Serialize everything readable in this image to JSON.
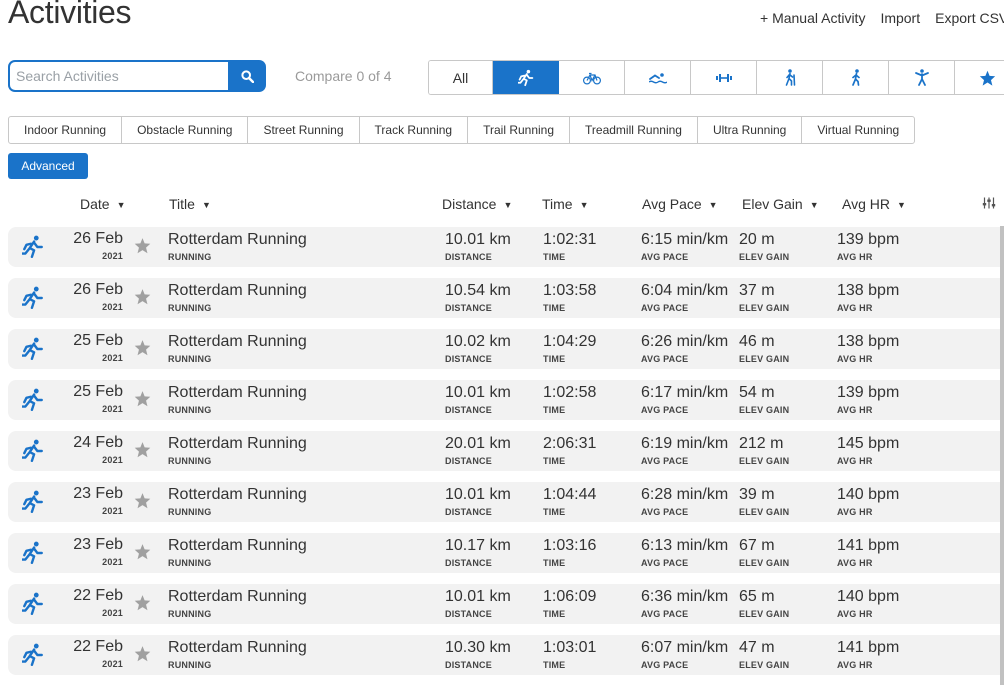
{
  "page": {
    "title": "Activities",
    "actions": [
      "+ Manual Activity",
      "Import",
      "Export CSV"
    ]
  },
  "search": {
    "placeholder": "Search Activities",
    "value": ""
  },
  "compare_label": "Compare 0 of 4",
  "filters": {
    "all_label": "All",
    "icons": [
      "running-icon",
      "cycling-icon",
      "swimming-icon",
      "strength-icon",
      "hiking-icon",
      "walking-icon",
      "fitness-icon",
      "favorites-star-icon"
    ],
    "active": "running-icon"
  },
  "subtypes": [
    "Indoor Running",
    "Obstacle Running",
    "Street Running",
    "Track Running",
    "Trail Running",
    "Treadmill Running",
    "Ultra Running",
    "Virtual Running"
  ],
  "advanced_label": "Advanced",
  "columns": {
    "date": "Date",
    "title": "Title",
    "distance": "Distance",
    "time": "Time",
    "pace": "Avg Pace",
    "elev": "Elev Gain",
    "hr": "Avg HR"
  },
  "sublabels": {
    "distance": "DISTANCE",
    "time": "TIME",
    "pace": "AVG PACE",
    "elev": "ELEV GAIN",
    "hr": "AVG HR"
  },
  "colors": {
    "accent": "#1a73c9",
    "row_bg": "#f2f2f2",
    "star": "#a0a0a0"
  },
  "activities": [
    {
      "date": "26 Feb",
      "year": "2021",
      "title": "Rotterdam Running",
      "type": "RUNNING",
      "distance": "10.01 km",
      "time": "1:02:31",
      "pace": "6:15 min/km",
      "elev": "20 m",
      "hr": "139 bpm"
    },
    {
      "date": "26 Feb",
      "year": "2021",
      "title": "Rotterdam Running",
      "type": "RUNNING",
      "distance": "10.54 km",
      "time": "1:03:58",
      "pace": "6:04 min/km",
      "elev": "37 m",
      "hr": "138 bpm"
    },
    {
      "date": "25 Feb",
      "year": "2021",
      "title": "Rotterdam Running",
      "type": "RUNNING",
      "distance": "10.02 km",
      "time": "1:04:29",
      "pace": "6:26 min/km",
      "elev": "46 m",
      "hr": "138 bpm"
    },
    {
      "date": "25 Feb",
      "year": "2021",
      "title": "Rotterdam Running",
      "type": "RUNNING",
      "distance": "10.01 km",
      "time": "1:02:58",
      "pace": "6:17 min/km",
      "elev": "54 m",
      "hr": "139 bpm"
    },
    {
      "date": "24 Feb",
      "year": "2021",
      "title": "Rotterdam Running",
      "type": "RUNNING",
      "distance": "20.01 km",
      "time": "2:06:31",
      "pace": "6:19 min/km",
      "elev": "212 m",
      "hr": "145 bpm"
    },
    {
      "date": "23 Feb",
      "year": "2021",
      "title": "Rotterdam Running",
      "type": "RUNNING",
      "distance": "10.01 km",
      "time": "1:04:44",
      "pace": "6:28 min/km",
      "elev": "39 m",
      "hr": "140 bpm"
    },
    {
      "date": "23 Feb",
      "year": "2021",
      "title": "Rotterdam Running",
      "type": "RUNNING",
      "distance": "10.17 km",
      "time": "1:03:16",
      "pace": "6:13 min/km",
      "elev": "67 m",
      "hr": "141 bpm"
    },
    {
      "date": "22 Feb",
      "year": "2021",
      "title": "Rotterdam Running",
      "type": "RUNNING",
      "distance": "10.01 km",
      "time": "1:06:09",
      "pace": "6:36 min/km",
      "elev": "65 m",
      "hr": "140 bpm"
    },
    {
      "date": "22 Feb",
      "year": "2021",
      "title": "Rotterdam Running",
      "type": "RUNNING",
      "distance": "10.30 km",
      "time": "1:03:01",
      "pace": "6:07 min/km",
      "elev": "47 m",
      "hr": "141 bpm"
    }
  ]
}
